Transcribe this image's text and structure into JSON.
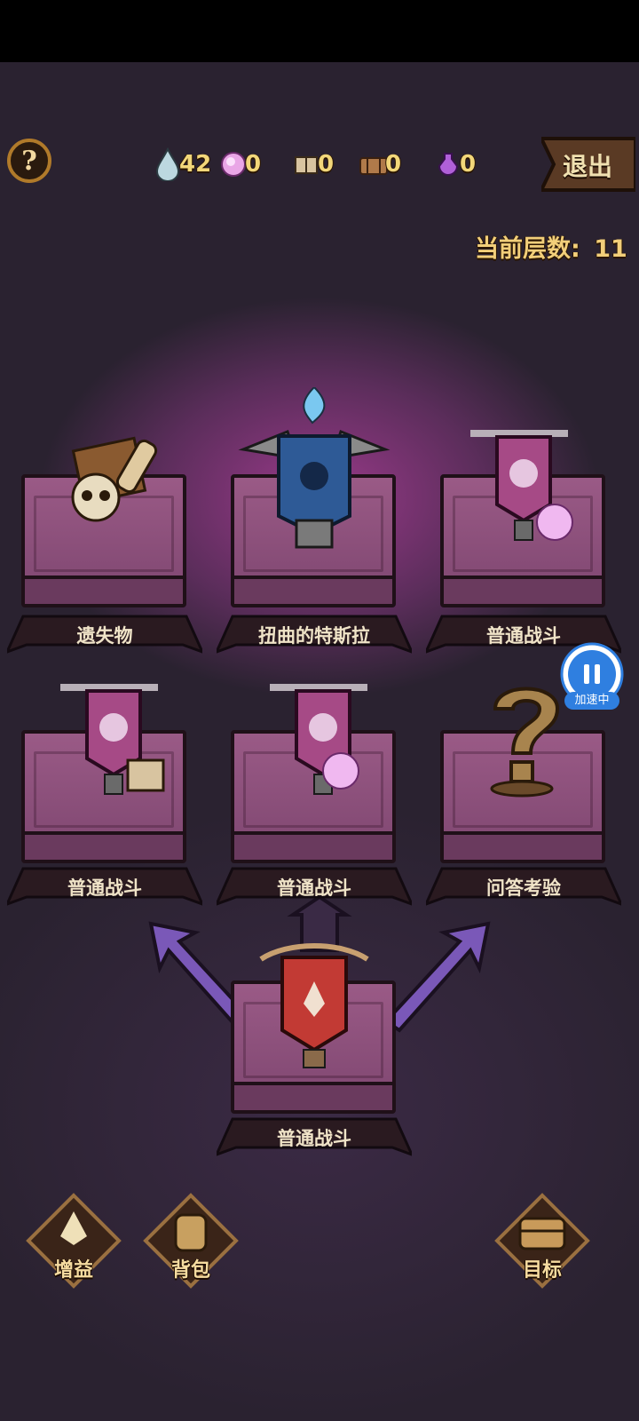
{
  "header": {
    "help_label": "?",
    "exit_label": "退出",
    "floor_label": "当前层数:",
    "floor_value": "11"
  },
  "resources": [
    {
      "icon": "water-drop-icon",
      "value": "42"
    },
    {
      "icon": "pink-orb-icon",
      "value": "0"
    },
    {
      "icon": "parcel-icon",
      "value": "0"
    },
    {
      "icon": "chest-icon",
      "value": "0"
    },
    {
      "icon": "potion-icon",
      "value": "0"
    }
  ],
  "nodes": [
    {
      "label": "遗失物",
      "icon": "skull-scroll-icon"
    },
    {
      "label": "扭曲的特斯拉",
      "icon": "boss-banner-icon"
    },
    {
      "label": "普通战斗",
      "icon": "battle-banner-orb-icon"
    },
    {
      "label": "普通战斗",
      "icon": "battle-banner-parcel-icon"
    },
    {
      "label": "普通战斗",
      "icon": "battle-banner-orb-icon"
    },
    {
      "label": "问答考验",
      "icon": "question-mark-icon"
    },
    {
      "label": "普通战斗",
      "icon": "current-red-banner-icon"
    }
  ],
  "bottom_bar": {
    "buff_label": "增益",
    "bag_label": "背包",
    "goal_label": "目标"
  },
  "speed_overlay": {
    "label": "加速中"
  },
  "colors": {
    "accent_gold": "#f2cf7a",
    "node_pink": "#9a5a86",
    "speed_blue": "#2f7fe0"
  }
}
